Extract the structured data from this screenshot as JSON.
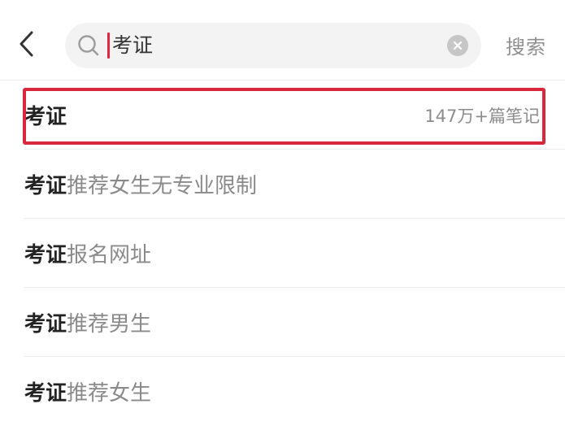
{
  "header": {
    "back_icon": "chevron-left-icon",
    "search": {
      "query": "考证",
      "search_icon": "search-icon",
      "clear_icon": "close-circle-icon"
    },
    "search_button_label": "搜索"
  },
  "suggestions": [
    {
      "keyword": "考证",
      "suffix": "",
      "count": "147万+篇笔记",
      "highlighted": true
    },
    {
      "keyword": "考证",
      "suffix": "推荐女生无专业限制",
      "count": ""
    },
    {
      "keyword": "考证",
      "suffix": "报名网址",
      "count": ""
    },
    {
      "keyword": "考证",
      "suffix": "推荐男生",
      "count": ""
    },
    {
      "keyword": "考证",
      "suffix": "推荐女生",
      "count": ""
    }
  ],
  "colors": {
    "highlight_border": "#d8283c",
    "cursor": "#e02840",
    "keyword_text": "#222222",
    "suffix_text": "#8a8a8a"
  }
}
